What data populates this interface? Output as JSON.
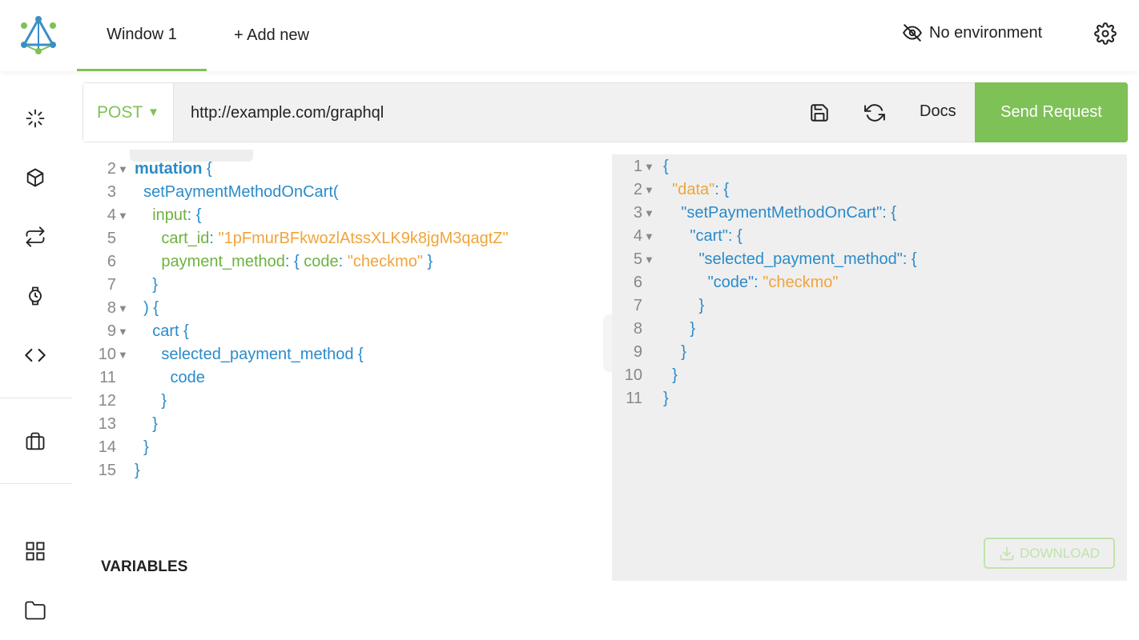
{
  "header": {
    "tabs": [
      {
        "label": "Window 1"
      },
      {
        "label": "+ Add new"
      }
    ],
    "environment": "No environment"
  },
  "request": {
    "method": "POST",
    "url": "http://example.com/graphql",
    "docs_label": "Docs",
    "send_label": "Send Request"
  },
  "query_lines": [
    {
      "n": "2",
      "fold": true,
      "tokens": [
        {
          "t": "mutation",
          "c": "kw"
        },
        {
          "t": " {",
          "c": "br"
        }
      ]
    },
    {
      "n": "3",
      "fold": false,
      "tokens": [
        {
          "t": "  setPaymentMethodOnCart(",
          "c": "fn"
        }
      ]
    },
    {
      "n": "4",
      "fold": true,
      "tokens": [
        {
          "t": "    input",
          "c": "arg"
        },
        {
          "t": ": {",
          "c": "br"
        }
      ]
    },
    {
      "n": "5",
      "fold": false,
      "tokens": [
        {
          "t": "      cart_id",
          "c": "arg"
        },
        {
          "t": ": ",
          "c": "br"
        },
        {
          "t": "\"1pFmurBFkwozlAtssXLK9k8jgM3qagtZ\"",
          "c": "str"
        }
      ]
    },
    {
      "n": "6",
      "fold": false,
      "tokens": [
        {
          "t": "      payment_method",
          "c": "arg"
        },
        {
          "t": ": { ",
          "c": "br"
        },
        {
          "t": "code",
          "c": "arg"
        },
        {
          "t": ": ",
          "c": "br"
        },
        {
          "t": "\"checkmo\"",
          "c": "str"
        },
        {
          "t": " }",
          "c": "br"
        }
      ]
    },
    {
      "n": "7",
      "fold": false,
      "tokens": [
        {
          "t": "    }",
          "c": "br"
        }
      ]
    },
    {
      "n": "8",
      "fold": true,
      "tokens": [
        {
          "t": "  ) {",
          "c": "br"
        }
      ]
    },
    {
      "n": "9",
      "fold": true,
      "tokens": [
        {
          "t": "    cart {",
          "c": "fn"
        }
      ]
    },
    {
      "n": "10",
      "fold": true,
      "tokens": [
        {
          "t": "      selected_payment_method {",
          "c": "fn"
        }
      ]
    },
    {
      "n": "11",
      "fold": false,
      "tokens": [
        {
          "t": "        code",
          "c": "fn"
        }
      ]
    },
    {
      "n": "12",
      "fold": false,
      "tokens": [
        {
          "t": "      }",
          "c": "br"
        }
      ]
    },
    {
      "n": "13",
      "fold": false,
      "tokens": [
        {
          "t": "    }",
          "c": "br"
        }
      ]
    },
    {
      "n": "14",
      "fold": false,
      "tokens": [
        {
          "t": "  }",
          "c": "br"
        }
      ]
    },
    {
      "n": "15",
      "fold": false,
      "tokens": [
        {
          "t": "}",
          "c": "br"
        }
      ]
    }
  ],
  "variables_label": "VARIABLES",
  "result_lines": [
    {
      "n": "1",
      "fold": true,
      "tokens": [
        {
          "t": "{",
          "c": "br"
        }
      ]
    },
    {
      "n": "2",
      "fold": true,
      "tokens": [
        {
          "t": "  \"data\"",
          "c": "keystr"
        },
        {
          "t": ": {",
          "c": "br"
        }
      ]
    },
    {
      "n": "3",
      "fold": true,
      "tokens": [
        {
          "t": "    \"setPaymentMethodOnCart\"",
          "c": "key"
        },
        {
          "t": ": {",
          "c": "br"
        }
      ]
    },
    {
      "n": "4",
      "fold": true,
      "tokens": [
        {
          "t": "      \"cart\"",
          "c": "key"
        },
        {
          "t": ": {",
          "c": "br"
        }
      ]
    },
    {
      "n": "5",
      "fold": true,
      "tokens": [
        {
          "t": "        \"selected_payment_method\"",
          "c": "key"
        },
        {
          "t": ": {",
          "c": "br"
        }
      ]
    },
    {
      "n": "6",
      "fold": false,
      "tokens": [
        {
          "t": "          \"code\"",
          "c": "key"
        },
        {
          "t": ": ",
          "c": "br"
        },
        {
          "t": "\"checkmo\"",
          "c": "str"
        }
      ]
    },
    {
      "n": "7",
      "fold": false,
      "tokens": [
        {
          "t": "        }",
          "c": "br"
        }
      ]
    },
    {
      "n": "8",
      "fold": false,
      "tokens": [
        {
          "t": "      }",
          "c": "br"
        }
      ]
    },
    {
      "n": "9",
      "fold": false,
      "tokens": [
        {
          "t": "    }",
          "c": "br"
        }
      ]
    },
    {
      "n": "10",
      "fold": false,
      "tokens": [
        {
          "t": "  }",
          "c": "br"
        }
      ]
    },
    {
      "n": "11",
      "fold": false,
      "tokens": [
        {
          "t": "}",
          "c": "br"
        }
      ]
    }
  ],
  "download_label": "DOWNLOAD",
  "colors": {
    "accent": "#7ec157",
    "keyword": "#2a8bc9",
    "string": "#f0a43a",
    "argument": "#6cb33e"
  },
  "sidebar_icons": [
    "loading-spinner-icon",
    "cube-icon",
    "swap-arrows-icon",
    "watch-icon",
    "code-brackets-icon",
    "briefcase-icon",
    "grid-icon",
    "folder-icon"
  ]
}
